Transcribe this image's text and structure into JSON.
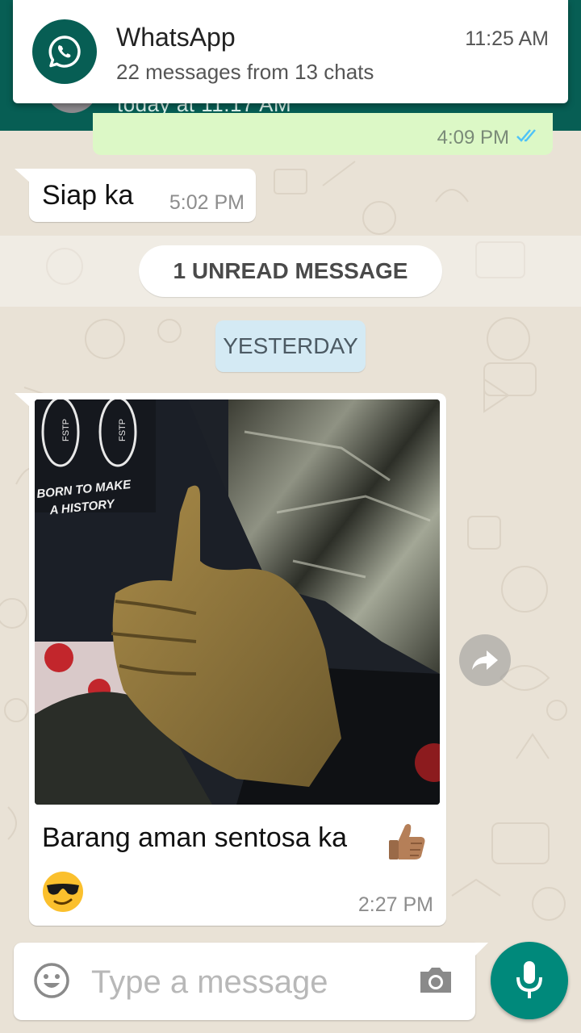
{
  "notification": {
    "app_name": "WhatsApp",
    "summary": "22 messages from 13 chats",
    "time": "11:25 AM",
    "icon": "whatsapp-logo-icon"
  },
  "header": {
    "last_seen": "today at 11:17 AM"
  },
  "messages": {
    "outgoing_partial": {
      "time": "4:09 PM",
      "status_icon": "double-check-icon"
    },
    "incoming_1": {
      "text": "Siap ka",
      "time": "5:02 PM"
    },
    "unread_banner": "1 UNREAD MESSAGE",
    "date_divider": "YESTERDAY",
    "image_message": {
      "photo_shirt_text_line1": "BORN TO MAKE",
      "photo_shirt_text_line2": "A HISTORY",
      "photo_shirt_brand": "FSTP",
      "caption": "Barang aman sentosa ka",
      "caption_emojis": [
        "thumbs-up-medium-skin",
        "smiling-face-with-sunglasses"
      ],
      "time": "2:27 PM"
    }
  },
  "composer": {
    "placeholder": "Type a message",
    "value": ""
  },
  "colors": {
    "header_teal": "#075e54",
    "outgoing_bubble": "#dcf8c6",
    "incoming_bubble": "#ffffff",
    "date_chip": "#d4eaf4",
    "mic_button": "#00897b",
    "wallpaper": "#e9e2d6",
    "read_ticks": "#4fc3f7"
  }
}
